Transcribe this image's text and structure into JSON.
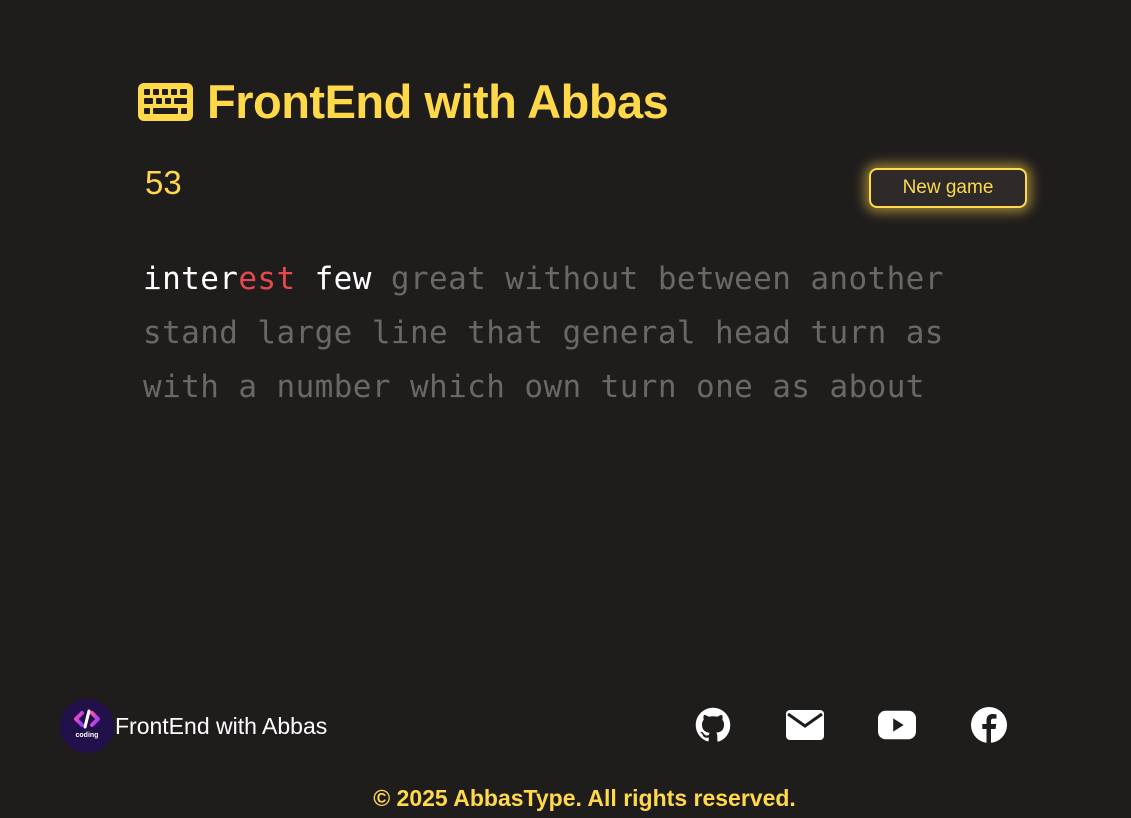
{
  "header": {
    "icon": "keyboard-icon",
    "title": "FrontEnd with Abbas"
  },
  "game": {
    "timer": "53",
    "new_game_label": "New game"
  },
  "words": {
    "typed": [
      {
        "correct": "inter",
        "incorrect": "est"
      },
      {
        "correct": "few",
        "incorrect": ""
      }
    ],
    "remaining": [
      "great",
      "without",
      "between",
      "another",
      "stand",
      "large",
      "line",
      "that",
      "general",
      "head",
      "turn",
      "as",
      "with",
      "a",
      "number",
      "which",
      "own",
      "turn",
      "one",
      "as",
      "about"
    ]
  },
  "footer": {
    "brand_logo_text": "coding",
    "brand_name": "FrontEnd with Abbas",
    "socials": [
      "github-icon",
      "envelope-icon",
      "youtube-icon",
      "facebook-icon"
    ],
    "copyright": "© 2025 AbbasType. All rights reserved."
  },
  "colors": {
    "accent": "#ffd94a",
    "background": "#1f1c1c",
    "typed": "#ffffff",
    "error": "#e5484d",
    "pending": "#6a6766"
  }
}
